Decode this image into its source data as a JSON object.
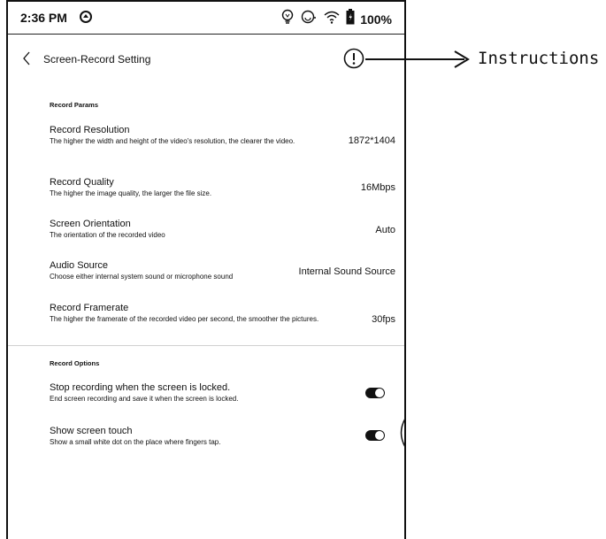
{
  "status": {
    "time": "2:36 PM",
    "battery": "100%"
  },
  "header": {
    "title": "Screen-Record Setting"
  },
  "annotation": {
    "label": "Instructions"
  },
  "params": {
    "section_title": "Record Params",
    "items": [
      {
        "title": "Record Resolution",
        "desc": "The higher the width and height of the video's resolution, the clearer the video.",
        "value": "1872*1404"
      },
      {
        "title": "Record Quality",
        "desc": "The higher the image quality, the larger the file size.",
        "value": "16Mbps"
      },
      {
        "title": "Screen Orientation",
        "desc": "The orientation of the recorded video",
        "value": "Auto"
      },
      {
        "title": "Audio Source",
        "desc": "Choose either internal system sound or microphone sound",
        "value": "Internal Sound Source"
      },
      {
        "title": "Record Framerate",
        "desc": "The higher the framerate of the recorded video per second, the smoother the pictures.",
        "value": "30fps"
      }
    ]
  },
  "options": {
    "section_title": "Record Options",
    "items": [
      {
        "title": "Stop recording when the screen is locked.",
        "desc": "End screen recording and save it when the screen is locked.",
        "enabled": true
      },
      {
        "title": "Show screen touch",
        "desc": "Show a small white dot on the place where fingers tap.",
        "enabled": true
      }
    ]
  },
  "icons": {
    "status": [
      "sync-icon",
      "bulb-icon",
      "refresh-icon",
      "wifi-icon",
      "battery-icon"
    ],
    "header": [
      "back-chevron-icon",
      "info-icon"
    ]
  },
  "colors": {
    "foreground": "#111111",
    "background": "#ffffff",
    "divider": "#d0d0d0"
  }
}
